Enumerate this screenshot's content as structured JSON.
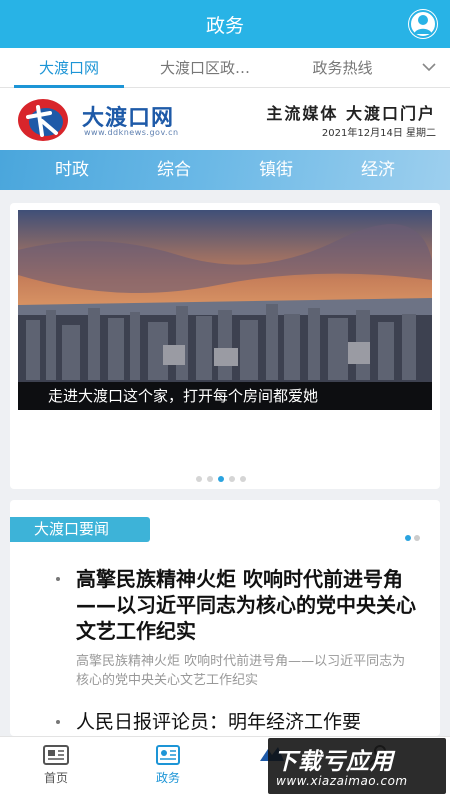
{
  "header": {
    "title": "政务"
  },
  "tabs": [
    {
      "label": "大渡口网"
    },
    {
      "label": "大渡口区政…"
    },
    {
      "label": "政务热线"
    }
  ],
  "site": {
    "logo_text": "大渡口网",
    "logo_url": "www.ddknews.gov.cn",
    "slogan": "主流媒体 大渡口门户",
    "date": "2021年12月14日 星期二"
  },
  "categories": [
    "时政",
    "综合",
    "镇街",
    "经济"
  ],
  "banner": {
    "caption": "走进大渡口这个家，打开每个房间都爱她",
    "slide_count": 5,
    "active_slide": 3
  },
  "news": {
    "section_label": "大渡口要闻",
    "items": [
      {
        "title": "高擎民族精神火炬 吹响时代前进号角——以习近平同志为核心的党中央关心文艺工作纪实",
        "summary": "高擎民族精神火炬 吹响时代前进号角——以习近平同志为核心的党中央关心文艺工作纪实"
      },
      {
        "title": "人民日报评论员：明年经济工作要"
      }
    ]
  },
  "bottom_nav": [
    {
      "label": "首页"
    },
    {
      "label": "政务"
    },
    {
      "label": ""
    },
    {
      "label": ""
    }
  ],
  "watermark": {
    "main": "下载亏应用",
    "url": "www.xiazaimao.com"
  },
  "colors": {
    "primary": "#28b3e6",
    "accent": "#1d95d6",
    "label_bg": "#3db3d8"
  }
}
